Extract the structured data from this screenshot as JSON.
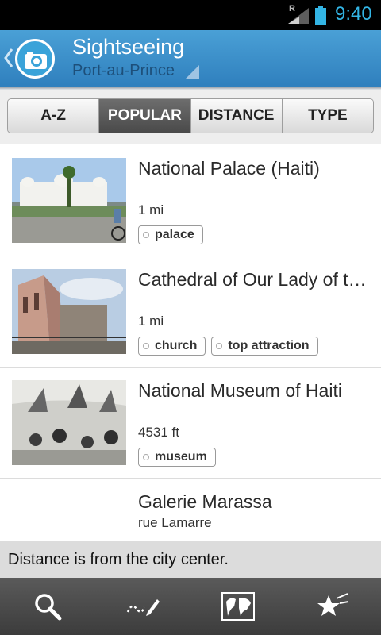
{
  "status_bar": {
    "time": "9:40",
    "roaming": "R"
  },
  "action_bar": {
    "title": "Sightseeing",
    "subtitle": "Port-au-Prince"
  },
  "tabs": [
    {
      "label": "A-Z",
      "active": false
    },
    {
      "label": "POPULAR",
      "active": true
    },
    {
      "label": "DISTANCE",
      "active": false
    },
    {
      "label": "TYPE",
      "active": false
    }
  ],
  "items": [
    {
      "title": "National Palace (Haiti)",
      "distance": "1 mi",
      "tags": [
        "palace"
      ]
    },
    {
      "title": "Cathedral of Our Lady of the Assumption",
      "distance": "1 mi",
      "tags": [
        "church",
        "top attraction"
      ]
    },
    {
      "title": "National Museum of Haiti",
      "distance": "4531 ft",
      "tags": [
        "museum"
      ]
    },
    {
      "title": "Galerie Marassa",
      "address": "rue Lamarre"
    }
  ],
  "note": "Distance is from the city center.",
  "bottom_bar": {
    "icons": [
      "search-icon",
      "draw-route-icon",
      "map-icon",
      "favorites-icon"
    ]
  }
}
